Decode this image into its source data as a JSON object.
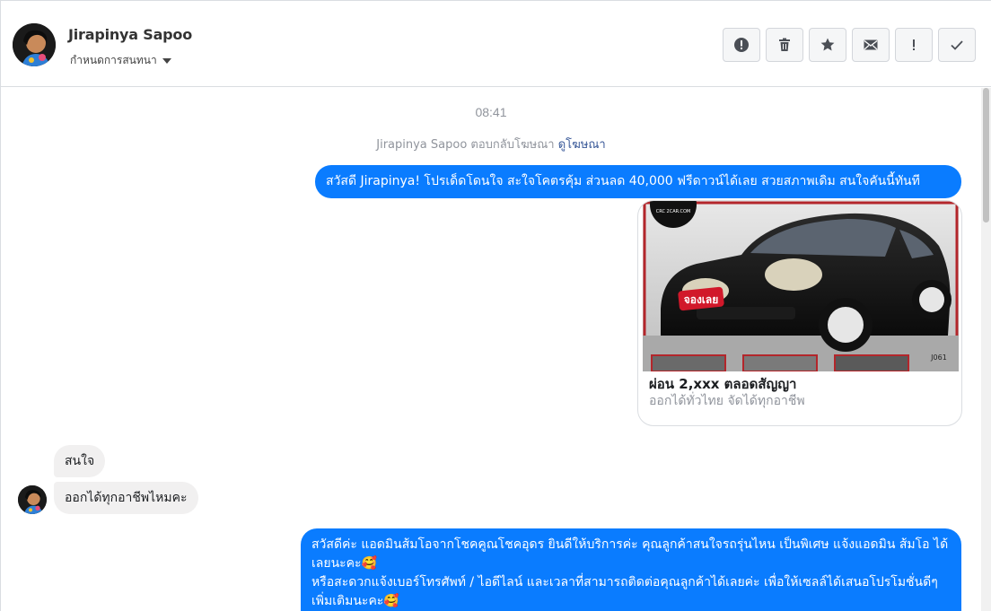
{
  "header": {
    "contact_name": "Jirapinya Sapoo",
    "assign_label": "กำหนดการสนทนา",
    "actions": [
      {
        "icon": "alert-circle-icon",
        "name": "report-button"
      },
      {
        "icon": "trash-icon",
        "name": "delete-button"
      },
      {
        "icon": "star-icon",
        "name": "star-button"
      },
      {
        "icon": "envelope-icon",
        "name": "mark-unread-button"
      },
      {
        "icon": "exclamation-icon",
        "name": "mark-spam-button"
      },
      {
        "icon": "check-icon",
        "name": "mark-done-button"
      }
    ]
  },
  "conversation": {
    "timestamp": "08:41",
    "reply_note": "Jirapinya Sapoo ตอบกลับโฆษณา",
    "reply_link": "ดูโฆษณา",
    "messages": [
      {
        "from": "page",
        "text": "สวัสดี Jirapinya! โปรเด็ดโดนใจ สะใจโคตรคุ้ม ส่วนลด 40,000 ฟรีดาวน์ได้เลย สวยสภาพเดิม สนใจคันนี้ทันที"
      },
      {
        "from": "user",
        "text": "สนใจ"
      },
      {
        "from": "user",
        "text": "ออกได้ทุกอาชีพไหมคะ"
      },
      {
        "from": "page",
        "lines": [
          "สวัสดีค่ะ แอดมินส้มโอจากโชคคูณโชคอุดร ยินดีให้บริการค่ะ  คุณลูกค้าสนใจรถรุ่นไหน เป็นพิเศษ แจ้งแอดมิน ส้มโอ ได้เลยนะคะ🥰",
          "หรือสะดวกแจ้งเบอร์โทรศัพท์ / ไอดีไลน์ และเวลาที่สามารถติดต่อคุณลูกค้าได้เลยค่ะ เพื่อให้เซลล์ได้เสนอโปรโมชั่นดีๆเพิ่มเติมนะคะ🥰"
        ]
      }
    ],
    "ad_card": {
      "title": "ผ่อน 2,xxx ตลอดสัญญา",
      "subtitle": "ออกได้ทั่วไทย จัดได้ทุกอาชีพ",
      "image_badge": "จองเลย",
      "image_logo": "CRC 2CAR.COM",
      "image_code": "J061"
    }
  },
  "colors": {
    "accent": "#0a7cff",
    "incoming_bubble": "#f1f0f0",
    "muted_text": "#90949c",
    "link": "#385898"
  }
}
